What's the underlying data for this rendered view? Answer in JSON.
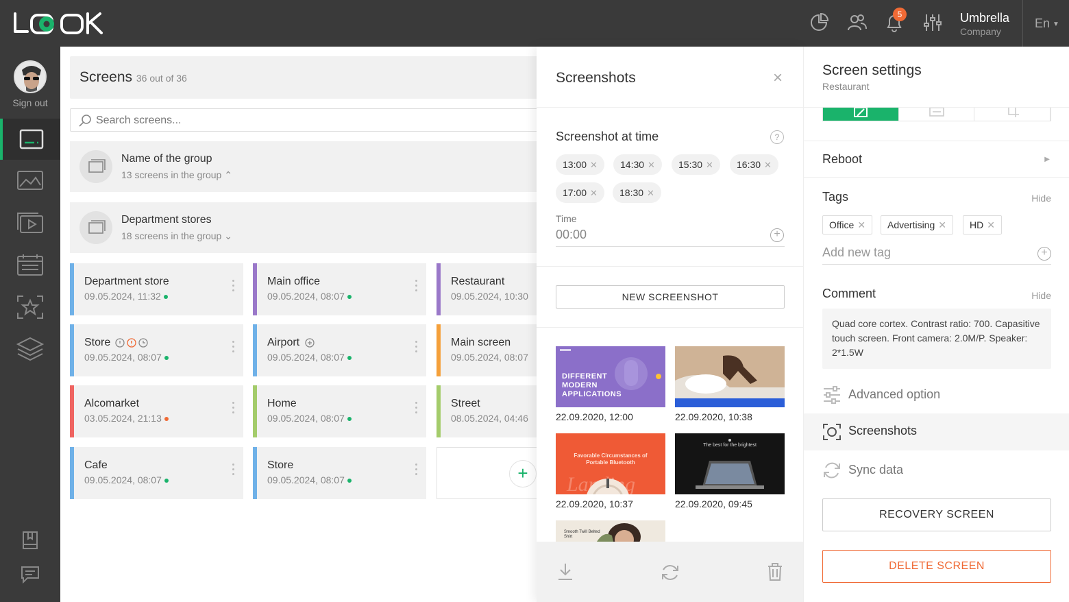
{
  "header": {
    "company_name": "Umbrella",
    "company_sub": "Company",
    "notification_count": "5",
    "language": "En",
    "icons": [
      "analytics-icon",
      "users-icon",
      "bell-icon",
      "sliders-icon"
    ]
  },
  "sidebar": {
    "sign_out": "Sign out",
    "items": [
      "screens-icon",
      "images-icon",
      "playlist-icon",
      "schedule-icon",
      "favorites-icon",
      "layers-icon"
    ],
    "bottom_items": [
      "book-icon",
      "chat-icon"
    ]
  },
  "main": {
    "title": "Screens",
    "count": "36 out of 36",
    "search_placeholder": "Search screens...",
    "groups": [
      {
        "name": "Name of the group",
        "sub": "13 screens in the group",
        "chevron": "⌃"
      },
      {
        "name": "Department stores",
        "sub": "18 screens in the group",
        "chevron": "⌄"
      }
    ],
    "cards": [
      {
        "name": "Department store",
        "date": "09.05.2024, 11:32"
      },
      {
        "name": "Main office",
        "date": "09.05.2024, 08:07"
      },
      {
        "name": "Restaurant",
        "date": "09.05.2024, 10:30"
      },
      {
        "name": "Store",
        "date": "09.05.2024, 08:07"
      },
      {
        "name": "Airport",
        "date": "09.05.2024, 08:07"
      },
      {
        "name": "Main screen",
        "date": "09.05.2024, 08:07"
      },
      {
        "name": "Alcomarket",
        "date": "03.05.2024, 21:13"
      },
      {
        "name": "Home",
        "date": "09.05.2024, 08:07"
      },
      {
        "name": "Street",
        "date": "08.05.2024, 04:46"
      },
      {
        "name": "Cafe",
        "date": "09.05.2024, 08:07"
      },
      {
        "name": "Store",
        "date": "09.05.2024, 08:07"
      }
    ]
  },
  "screenshots": {
    "title": "Screenshots",
    "section_title": "Screenshot at time",
    "times": [
      "13:00",
      "14:30",
      "15:30",
      "16:30",
      "17:00",
      "18:30"
    ],
    "time_label": "Time",
    "time_value": "00:00",
    "new_button": "NEW SCREENSHOT",
    "thumb_dates": [
      "22.09.2020, 12:00",
      "22.09.2020, 10:38",
      "22.09.2020, 10:37",
      "22.09.2020, 09:45"
    ],
    "thumb1_text": "DIFFERENT MODERN APPLICATIONS",
    "thumb3_text": "Favorable Circumstances of Portable Bluetooth",
    "thumb4_text": "The best for the brightest",
    "thumb5_text": "Smooth Twill Belted Shirt"
  },
  "settings": {
    "title": "Screen settings",
    "subtitle": "Restaurant",
    "reboot": "Reboot",
    "tags_title": "Tags",
    "tags_hide": "Hide",
    "tags": [
      "Office",
      "Advertising",
      "HD"
    ],
    "tag_placeholder": "Add new tag",
    "comment_title": "Comment",
    "comment_hide": "Hide",
    "comment_text": "Quad core cortex. Contrast ratio: 700. Capasitive touch screen. Front camera: 2.0M/P. Speaker: 2*1.5W",
    "advanced": "Advanced option",
    "screenshots": "Screenshots",
    "sync": "Sync data",
    "recovery": "RECOVERY SCREEN",
    "delete": "DELETE SCREEN"
  },
  "colors": {
    "accent": "#1ab36b",
    "danger": "#f06a35",
    "dark": "#3a3a3a"
  }
}
